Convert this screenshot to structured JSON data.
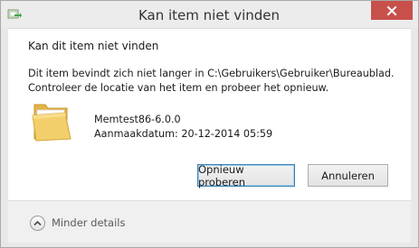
{
  "window": {
    "title": "Kan item niet vinden"
  },
  "dialog": {
    "headline": "Kan dit item niet vinden",
    "message_line1": "Dit item bevindt zich niet langer in C:\\Gebruikers\\Gebruiker\\Bureaublad.",
    "message_line2": "Controleer de locatie van het item en probeer het opnieuw."
  },
  "item": {
    "name": "Memtest86-6.0.0",
    "created": "Aanmaakdatum: 20-12-2014 05:59",
    "icon": "folder-icon"
  },
  "buttons": {
    "retry_label": "Opnieuw proberen",
    "cancel_label": "Annuleren"
  },
  "footer": {
    "details_label": "Minder details",
    "icon": "chevron-up-icon"
  },
  "colors": {
    "close_button": "#c7504b",
    "primary_border": "#3c7fb1",
    "folder": "#f3cf6b"
  }
}
